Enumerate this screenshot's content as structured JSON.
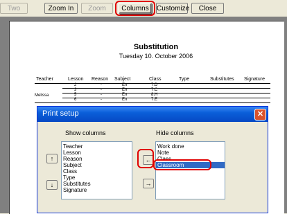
{
  "toolbar": {
    "two_pages": "Two pages",
    "zoom_in": "Zoom In",
    "zoom_out": "Zoom Out",
    "columns": "Columns",
    "customize": "Customize",
    "close": "Close"
  },
  "report": {
    "title": "Substitution",
    "date": "Tuesday 10. October 2006",
    "headers": [
      "Teacher",
      "Lesson",
      "Reason",
      "Subject",
      "Class",
      "Type",
      "Substitutes",
      "Signature"
    ],
    "teacher": "Melissa",
    "rows": [
      {
        "lesson": "2",
        "reason": "-",
        "subject": "En",
        "class": "7.D"
      },
      {
        "lesson": "3",
        "reason": "-",
        "subject": "En",
        "class": "7.C"
      },
      {
        "lesson": "5",
        "reason": "-",
        "subject": "En",
        "class": "8.H"
      },
      {
        "lesson": "6",
        "reason": "-",
        "subject": "En",
        "class": "7.E"
      }
    ]
  },
  "dialog": {
    "title": "Print setup",
    "show_label": "Show columns",
    "hide_label": "Hide columns",
    "show_items": [
      "Teacher",
      "Lesson",
      "Reason",
      "Subject",
      "Class",
      "Type",
      "Substitutes",
      "Signature"
    ],
    "hide_items": [
      "Work done",
      "Note",
      "Class",
      "Classroom"
    ],
    "selected_hide_index": 3
  },
  "icons": {
    "up": "up-arrow-icon",
    "down": "down-arrow-icon",
    "left": "left-arrow-icon",
    "right": "right-arrow-icon",
    "close": "close-icon"
  },
  "colors": {
    "highlight": "#e00000",
    "selection": "#316ac5",
    "titlebar": "#0a5fd9"
  }
}
